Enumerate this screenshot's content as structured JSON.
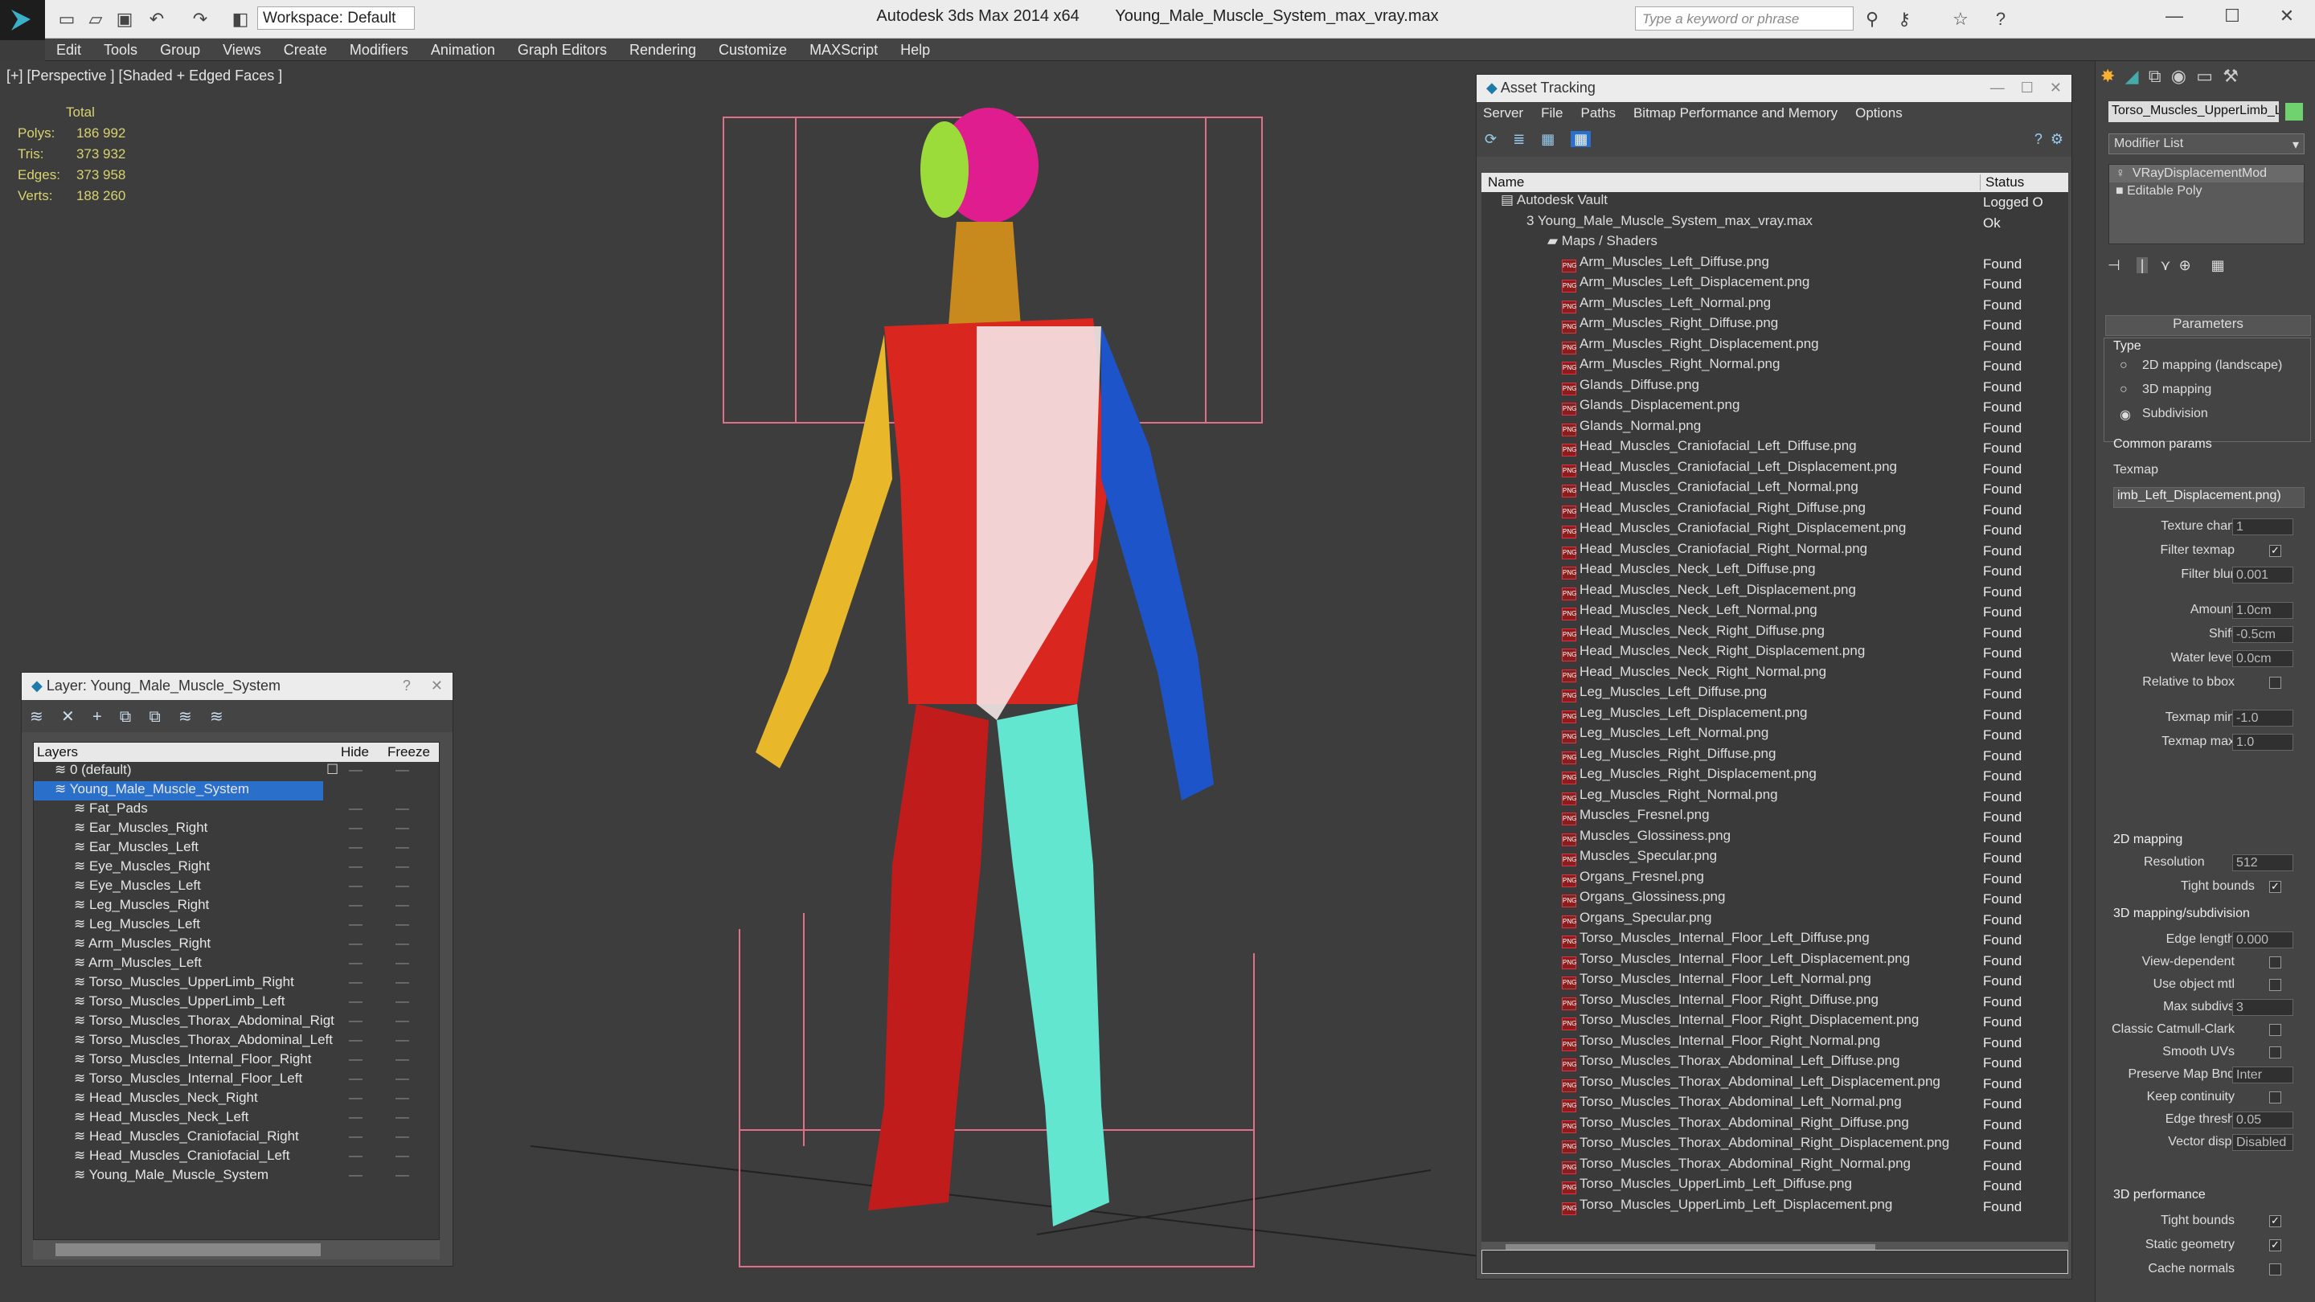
{
  "app": {
    "title": "Autodesk 3ds Max 2014 x64",
    "file": "Young_Male_Muscle_System_max_vray.max",
    "workspace": "Workspace: Default",
    "search_placeholder": "Type a keyword or phrase"
  },
  "menu": [
    "Edit",
    "Tools",
    "Group",
    "Views",
    "Create",
    "Modifiers",
    "Animation",
    "Graph Editors",
    "Rendering",
    "Customize",
    "MAXScript",
    "Help"
  ],
  "viewport": {
    "label": "[+] [Perspective ] [Shaded + Edged Faces ]",
    "stats": {
      "header": "Total",
      "rows": [
        [
          "Polys:",
          "186 992"
        ],
        [
          "Tris:",
          "373 932"
        ],
        [
          "Edges:",
          "373 958"
        ],
        [
          "Verts:",
          "188 260"
        ]
      ]
    }
  },
  "asset_tracking": {
    "title": "Asset Tracking",
    "menu": [
      "Server",
      "File",
      "Paths",
      "Bitmap Performance and Memory",
      "Options"
    ],
    "columns": [
      "Name",
      "Status"
    ],
    "vault": {
      "name": "Autodesk Vault",
      "status": "Logged O"
    },
    "file": {
      "name": "Young_Male_Muscle_System_max_vray.max",
      "status": "Ok"
    },
    "group": "Maps / Shaders",
    "maps": [
      "Arm_Muscles_Left_Diffuse.png",
      "Arm_Muscles_Left_Displacement.png",
      "Arm_Muscles_Left_Normal.png",
      "Arm_Muscles_Right_Diffuse.png",
      "Arm_Muscles_Right_Displacement.png",
      "Arm_Muscles_Right_Normal.png",
      "Glands_Diffuse.png",
      "Glands_Displacement.png",
      "Glands_Normal.png",
      "Head_Muscles_Craniofacial_Left_Diffuse.png",
      "Head_Muscles_Craniofacial_Left_Displacement.png",
      "Head_Muscles_Craniofacial_Left_Normal.png",
      "Head_Muscles_Craniofacial_Right_Diffuse.png",
      "Head_Muscles_Craniofacial_Right_Displacement.png",
      "Head_Muscles_Craniofacial_Right_Normal.png",
      "Head_Muscles_Neck_Left_Diffuse.png",
      "Head_Muscles_Neck_Left_Displacement.png",
      "Head_Muscles_Neck_Left_Normal.png",
      "Head_Muscles_Neck_Right_Diffuse.png",
      "Head_Muscles_Neck_Right_Displacement.png",
      "Head_Muscles_Neck_Right_Normal.png",
      "Leg_Muscles_Left_Diffuse.png",
      "Leg_Muscles_Left_Displacement.png",
      "Leg_Muscles_Left_Normal.png",
      "Leg_Muscles_Right_Diffuse.png",
      "Leg_Muscles_Right_Displacement.png",
      "Leg_Muscles_Right_Normal.png",
      "Muscles_Fresnel.png",
      "Muscles_Glossiness.png",
      "Muscles_Specular.png",
      "Organs_Fresnel.png",
      "Organs_Glossiness.png",
      "Organs_Specular.png",
      "Torso_Muscles_Internal_Floor_Left_Diffuse.png",
      "Torso_Muscles_Internal_Floor_Left_Displacement.png",
      "Torso_Muscles_Internal_Floor_Left_Normal.png",
      "Torso_Muscles_Internal_Floor_Right_Diffuse.png",
      "Torso_Muscles_Internal_Floor_Right_Displacement.png",
      "Torso_Muscles_Internal_Floor_Right_Normal.png",
      "Torso_Muscles_Thorax_Abdominal_Left_Diffuse.png",
      "Torso_Muscles_Thorax_Abdominal_Left_Displacement.png",
      "Torso_Muscles_Thorax_Abdominal_Left_Normal.png",
      "Torso_Muscles_Thorax_Abdominal_Right_Diffuse.png",
      "Torso_Muscles_Thorax_Abdominal_Right_Displacement.png",
      "Torso_Muscles_Thorax_Abdominal_Right_Normal.png",
      "Torso_Muscles_UpperLimb_Left_Diffuse.png",
      "Torso_Muscles_UpperLimb_Left_Displacement.png"
    ],
    "status_found": "Found"
  },
  "layer_panel": {
    "title": "Layer: Young_Male_Muscle_System",
    "columns": [
      "Layers",
      "Hide",
      "Freeze"
    ],
    "default_layer": "0 (default)",
    "active_layer": "Young_Male_Muscle_System",
    "layers": [
      "Fat_Pads",
      "Ear_Muscles_Right",
      "Ear_Muscles_Left",
      "Eye_Muscles_Right",
      "Eye_Muscles_Left",
      "Leg_Muscles_Right",
      "Leg_Muscles_Left",
      "Arm_Muscles_Right",
      "Arm_Muscles_Left",
      "Torso_Muscles_UpperLimb_Right",
      "Torso_Muscles_UpperLimb_Left",
      "Torso_Muscles_Thorax_Abdominal_Rigt",
      "Torso_Muscles_Thorax_Abdominal_Left",
      "Torso_Muscles_Internal_Floor_Right",
      "Torso_Muscles_Internal_Floor_Left",
      "Head_Muscles_Neck_Right",
      "Head_Muscles_Neck_Left",
      "Head_Muscles_Craniofacial_Right",
      "Head_Muscles_Craniofacial_Left",
      "Young_Male_Muscle_System"
    ]
  },
  "command_panel": {
    "object_name": "Torso_Muscles_UpperLimb_Le",
    "modifier_list": "Modifier List",
    "stack": [
      "VRayDisplacementMod",
      "Editable Poly"
    ],
    "rollout": "Parameters",
    "type_label": "Type",
    "type_options": [
      "2D mapping (landscape)",
      "3D mapping",
      "Subdivision"
    ],
    "common": "Common params",
    "texmap_label": "Texmap",
    "texmap_value": "imb_Left_Displacement.png)",
    "fields": [
      {
        "label": "Texture chan",
        "value": "1"
      },
      {
        "label": "Filter texmap",
        "check": "✓"
      },
      {
        "label": "Filter blur",
        "value": "0.001"
      },
      {
        "label": "Amount",
        "value": "1.0cm"
      },
      {
        "label": "Shift",
        "value": "-0.5cm"
      },
      {
        "label": "Water level",
        "value": "0.0cm"
      },
      {
        "label": "Relative to bbox",
        "check": ""
      },
      {
        "label": "Texmap min",
        "value": "-1.0"
      },
      {
        "label": "Texmap max",
        "value": "1.0"
      }
    ],
    "mapping2d": "2D mapping",
    "resolution_label": "Resolution",
    "resolution": "512",
    "tight_bounds": "Tight bounds",
    "mapping3d": "3D mapping/subdivision",
    "fields3d": [
      {
        "label": "Edge length",
        "value": "0.000"
      },
      {
        "label": "View-dependent",
        "check": ""
      },
      {
        "label": "Use object mtl",
        "check": ""
      },
      {
        "label": "Max subdivs",
        "value": "3"
      },
      {
        "label": "Classic Catmull-Clark",
        "check": ""
      },
      {
        "label": "Smooth UVs",
        "check": ""
      },
      {
        "label": "Preserve Map Bnd",
        "value": "Inter"
      },
      {
        "label": "Keep continuity",
        "check": ""
      },
      {
        "label": "Edge thresh",
        "value": "0.05"
      },
      {
        "label": "Vector displ",
        "value": "Disabled"
      }
    ],
    "perf": "3D performance",
    "perf_fields": [
      {
        "label": "Tight bounds",
        "check": "✓"
      },
      {
        "label": "Static geometry",
        "check": "✓"
      },
      {
        "label": "Cache normals",
        "check": ""
      }
    ]
  }
}
